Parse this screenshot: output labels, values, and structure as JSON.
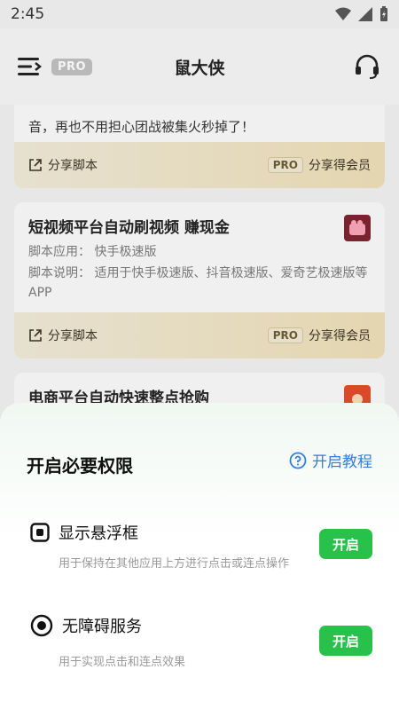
{
  "status": {
    "time": "2:45"
  },
  "header": {
    "pro": "PRO",
    "title": "鼠大侠"
  },
  "card1": {
    "partial_text_line1": "...",
    "partial_text_line2": "音，再也不用担心团战被集火秒掉了！",
    "share_script": "分享脚本",
    "pro": "PRO",
    "share_member": "分享得会员"
  },
  "card2": {
    "title": "短视频平台自动刷视频 赚现金",
    "app_label": "脚本应用：",
    "app_value": "快手极速版",
    "desc_label": "脚本说明：",
    "desc_value": "适用于快手极速版、抖音极速版、爱奇艺极速版等APP",
    "share_script": "分享脚本",
    "pro": "PRO",
    "share_member": "分享得会员"
  },
  "card3": {
    "title": "电商平台自动快速整点抢购"
  },
  "sheet": {
    "title": "开启必要权限",
    "tutorial": "开启教程",
    "permissions": [
      {
        "title": "显示悬浮框",
        "desc": "用于保持在其他应用上方进行点击或连点操作",
        "button": "开启"
      },
      {
        "title": "无障碍服务",
        "desc": "用于实现点击和连点效果",
        "button": "开启"
      }
    ]
  },
  "colors": {
    "accent_green": "#28c24a",
    "link_blue": "#2f7fe0"
  }
}
